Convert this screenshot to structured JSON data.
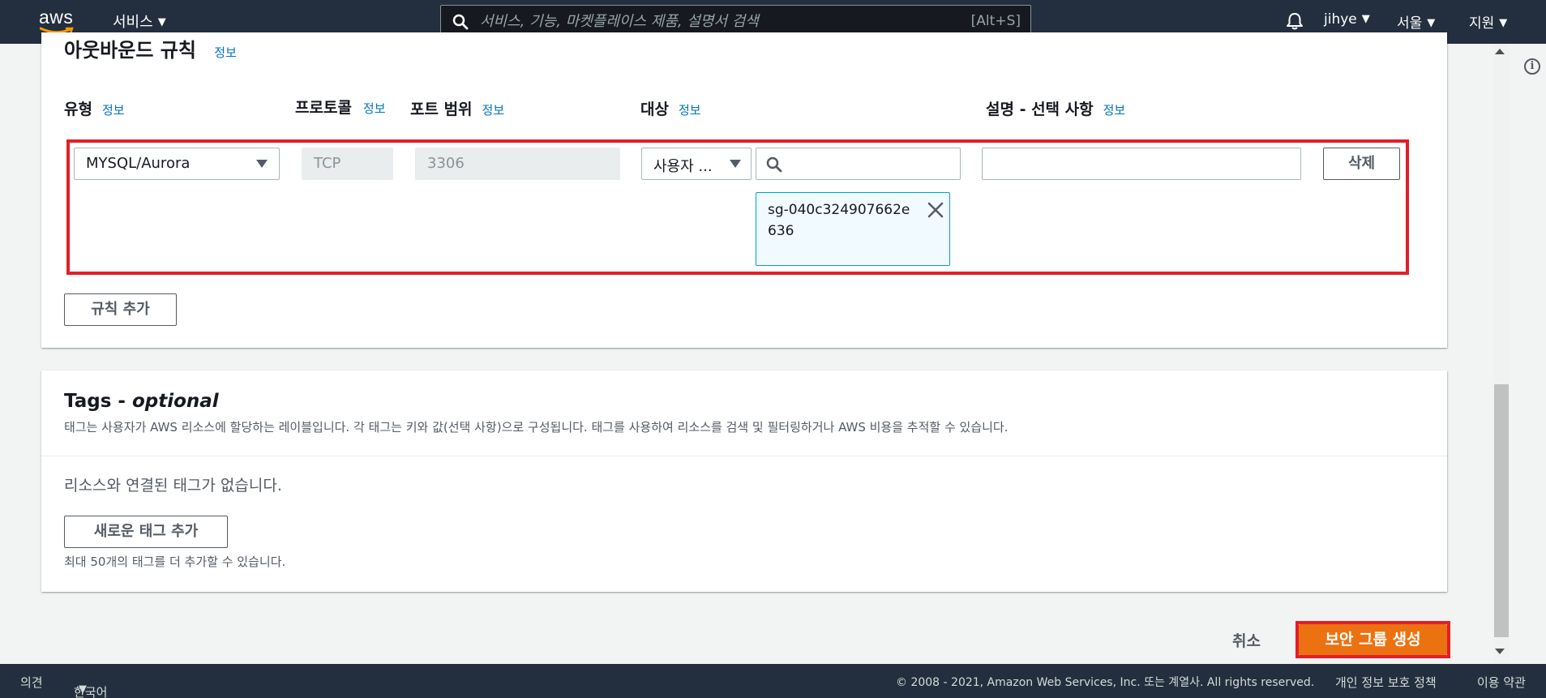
{
  "nav": {
    "logo_text": "aws",
    "services_label": "서비스",
    "search_placeholder": "서비스, 기능, 마켓플레이스 제품, 설명서 검색",
    "search_shortcut": "[Alt+S]",
    "user_label": "jihye",
    "region_label": "서울",
    "support_label": "지원"
  },
  "outbound": {
    "title": "아웃바운드 규칙",
    "info_label": "정보",
    "columns": {
      "type": "유형",
      "protocol": "프로토콜",
      "port_range": "포트 범위",
      "destination": "대상",
      "description": "설명 - 선택 사항"
    },
    "rule": {
      "type_value": "MYSQL/Aurora",
      "protocol_value": "TCP",
      "port_value": "3306",
      "destination_type": "사용자 ...",
      "destination_search": "",
      "selected_group": "sg-040c324907662e636",
      "description_value": "",
      "delete_label": "삭제"
    },
    "add_rule_label": "규칙 추가"
  },
  "tags": {
    "title_prefix": "Tags - ",
    "title_optional": "optional",
    "description": "태그는 사용자가 AWS 리소스에 할당하는 레이블입니다. 각 태그는 키와 값(선택 사항)으로 구성됩니다. 태그를 사용하여 리소스를 검색 및 필터링하거나 AWS 비용을 추적할 수 있습니다.",
    "empty_text": "리소스와 연결된 태그가 없습니다.",
    "add_tag_label": "새로운 태그 추가",
    "limit_text": "최대 50개의 태그를 더 추가할 수 있습니다."
  },
  "actions": {
    "cancel_label": "취소",
    "create_label": "보안 그룹 생성"
  },
  "footer": {
    "feedback_label": "의견",
    "language_label": "한국어",
    "copyright": "© 2008 - 2021, Amazon Web Services, Inc. 또는 계열사. All rights reserved.",
    "privacy_label": "개인 정보 보호 정책",
    "terms_label": "이용 약관"
  },
  "colors": {
    "nav_bg": "#232f3e",
    "primary": "#ec7211",
    "link": "#0073bb",
    "highlight": "#e21e27",
    "token_border": "#00a1c9"
  }
}
